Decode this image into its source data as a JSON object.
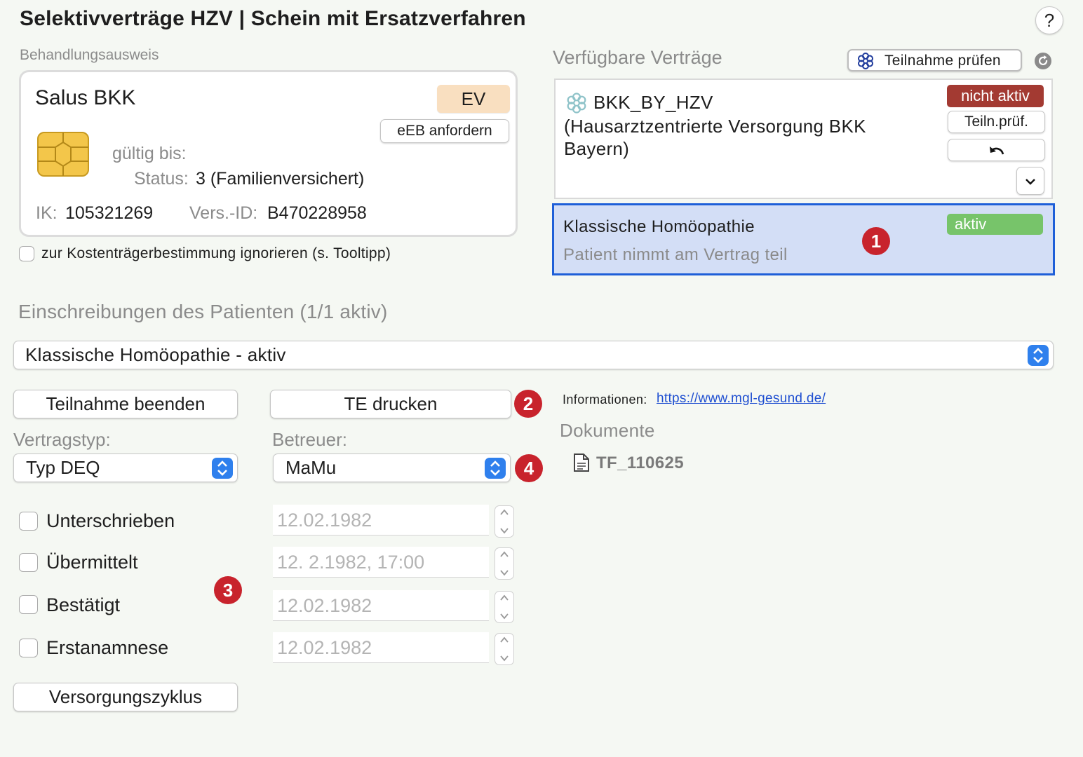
{
  "title": "Selektivverträge HZV | Schein mit Ersatzverfahren",
  "help_label": "?",
  "card": {
    "section_label": "Behandlungsausweis",
    "insurer": "Salus BKK",
    "ev_label": "EV",
    "eeb_button": "eEB anfordern",
    "valid_label": "gültig bis:",
    "status_label": "Status:",
    "status_value": "3 (Familienversichert)",
    "ik_label": "IK:",
    "ik_value": "105321269",
    "vers_label": "Vers.-ID:",
    "vers_value": "B470228958",
    "ignore_checkbox_label": "zur Kostenträgerbestimmung ignorieren (s. Tooltipp)"
  },
  "contracts": {
    "section_label": "Verfügbare Verträge",
    "check_button": "Teilnahme prüfen",
    "items": [
      {
        "name_line1": "BKK_BY_HZV",
        "name_line2": "(Hausarztzentrierte Versorgung BKK",
        "name_line3": "Bayern)",
        "status": "nicht aktiv",
        "check_button": "Teiln.prüf.",
        "status_color": "#a33a32"
      },
      {
        "name": "Klassische Homöopathie",
        "subtitle": "Patient nimmt am Vertrag teil",
        "status": "aktiv",
        "status_color": "#77c46a"
      }
    ]
  },
  "enrollments": {
    "section_label": "Einschreibungen des Patienten (1/1 aktiv)",
    "selected": "Klassische Homöopathie - aktiv"
  },
  "actions": {
    "end_participation": "Teilnahme beenden",
    "print_te": "TE drucken",
    "care_cycle": "Versorgungszyklus"
  },
  "contract_type": {
    "label": "Vertragstyp:",
    "value": "Typ DEQ"
  },
  "supervisor": {
    "label": "Betreuer:",
    "value": "MaMu"
  },
  "info": {
    "label": "Informationen:",
    "link": "https://www.mgl-gesund.de/"
  },
  "documents": {
    "label": "Dokumente",
    "items": [
      "TF_110625"
    ]
  },
  "checkpoints": [
    {
      "label": "Unterschrieben",
      "date": "12.02.1982"
    },
    {
      "label": "Übermittelt",
      "date": "12.  2.1982, 17:00"
    },
    {
      "label": "Bestätigt",
      "date": "12.02.1982"
    },
    {
      "label": "Erstanamnese",
      "date": "12.02.1982"
    }
  ],
  "markers": [
    "1",
    "2",
    "3",
    "4"
  ],
  "icons": {
    "chip": "chip-icon",
    "check": "snowflake-icon",
    "refresh": "refresh-icon",
    "undo": "undo-icon",
    "expand": "chevron-down-icon",
    "document": "document-icon",
    "select": "updown-chevron-icon"
  }
}
